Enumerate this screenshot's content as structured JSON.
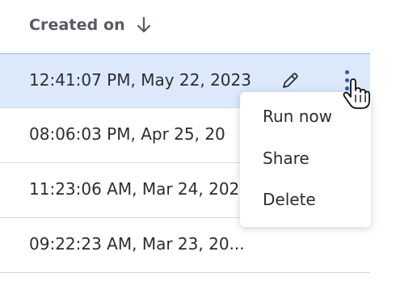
{
  "table": {
    "column_header": "Created on",
    "sort_icon": "arrow-down-icon",
    "rows": [
      {
        "created_on": "12:41:07 PM, May 22, 2023",
        "selected": true
      },
      {
        "created_on": "08:06:03 PM, Apr 25, 20"
      },
      {
        "created_on": "11:23:06 AM, Mar 24, 202"
      },
      {
        "created_on": "09:22:23 AM, Mar 23, 20..."
      }
    ],
    "row_actions": {
      "edit_icon": "pencil-icon",
      "more_icon": "kebab-menu-icon"
    }
  },
  "menu": {
    "items": [
      "Run now",
      "Share",
      "Delete"
    ]
  },
  "colors": {
    "selected_row_bg": "#dce9fb",
    "accent": "#2d5aa8",
    "text": "#2b2d33",
    "header_text": "#555b66"
  }
}
